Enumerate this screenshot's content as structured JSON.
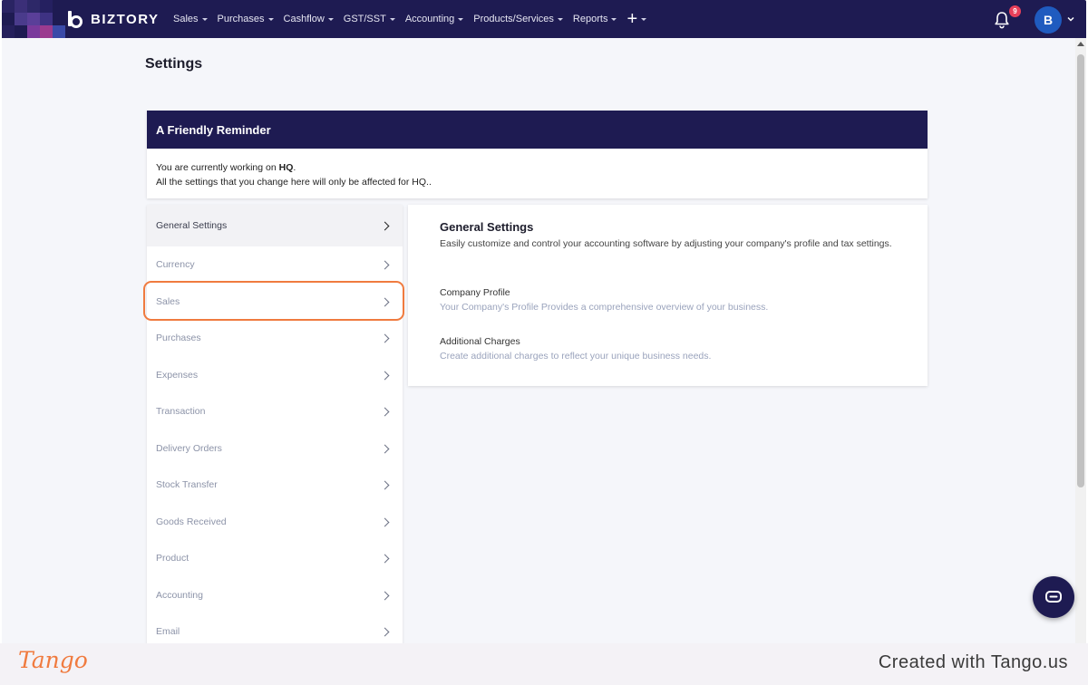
{
  "app": {
    "brand": "BIZTORY",
    "notifications_count": "9",
    "avatar_initial": "B"
  },
  "nav": {
    "items": [
      "Sales",
      "Purchases",
      "Cashflow",
      "GST/SST",
      "Accounting",
      "Products/Services",
      "Reports"
    ],
    "add": "+"
  },
  "page": {
    "title": "Settings"
  },
  "reminder": {
    "heading": "A Friendly Reminder",
    "line1_prefix": "You are currently working on ",
    "line1_branch": "HQ",
    "line1_suffix": ".",
    "line2": "All the settings that you change here will only be affected for HQ.."
  },
  "menu": {
    "items": [
      "General Settings",
      "Currency",
      "Sales",
      "Purchases",
      "Expenses",
      "Transaction",
      "Delivery Orders",
      "Stock Transfer",
      "Goods Received",
      "Product",
      "Accounting",
      "Email"
    ],
    "active": "General Settings"
  },
  "panel": {
    "title": "General Settings",
    "description": "Easily customize and control your accounting software by adjusting your company's profile and tax settings.",
    "options": [
      {
        "title": "Company Profile",
        "description": "Your Company's Profile Provides a comprehensive overview of your business."
      },
      {
        "title": "Additional Charges",
        "description": "Create additional charges to reflect your unique business needs."
      }
    ]
  },
  "footer": {
    "logo": "Tango",
    "credit": "Created with Tango.us"
  },
  "colors": {
    "navy": "#1e1b52",
    "highlight": "#f07b3f",
    "badge": "#e8405a",
    "avatar": "#1f5bbf"
  }
}
